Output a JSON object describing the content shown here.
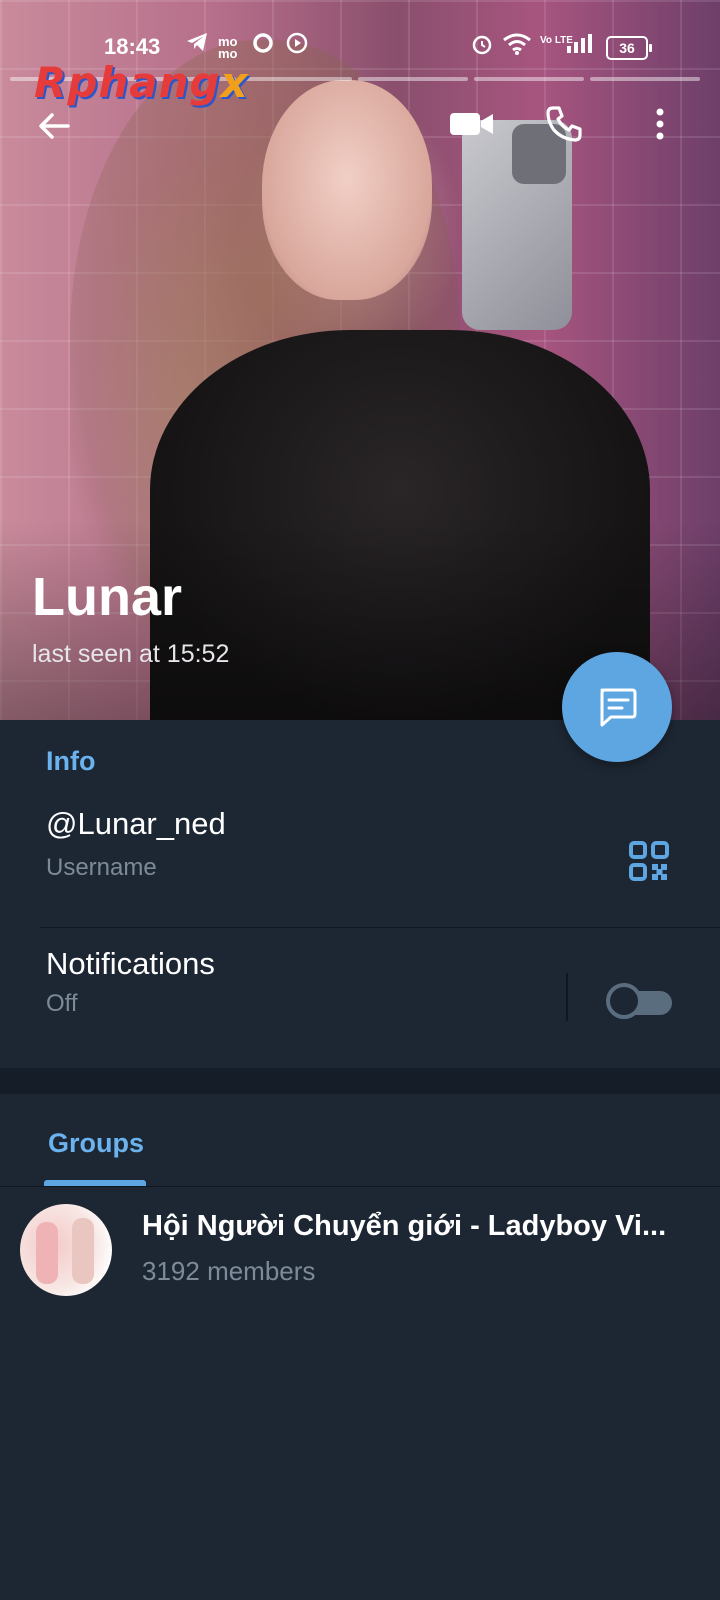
{
  "status_bar": {
    "time": "18:43",
    "battery": "36",
    "volte": "Vo LTE"
  },
  "watermark": {
    "text": "Rphang",
    "suffix": "x"
  },
  "profile": {
    "name": "Lunar",
    "last_seen": "last seen at 15:52"
  },
  "info": {
    "section_title": "Info",
    "username": "@Lunar_ned",
    "username_label": "Username",
    "notifications_label": "Notifications",
    "notifications_value": "Off",
    "notifications_enabled": false
  },
  "groups": {
    "tab_label": "Groups",
    "items": [
      {
        "name": "Hội Người Chuyển giới - Ladyboy Vi...",
        "members": "3192 members"
      }
    ]
  },
  "colors": {
    "accent": "#5ea6e1",
    "section_title": "#6bb3ef",
    "background": "#1d2733",
    "secondary_text": "#7d8b99"
  },
  "icons": {
    "back": "arrow-left-icon",
    "video": "video-call-icon",
    "call": "phone-icon",
    "more": "more-vertical-icon",
    "fab": "message-icon",
    "qr": "qr-code-icon"
  }
}
